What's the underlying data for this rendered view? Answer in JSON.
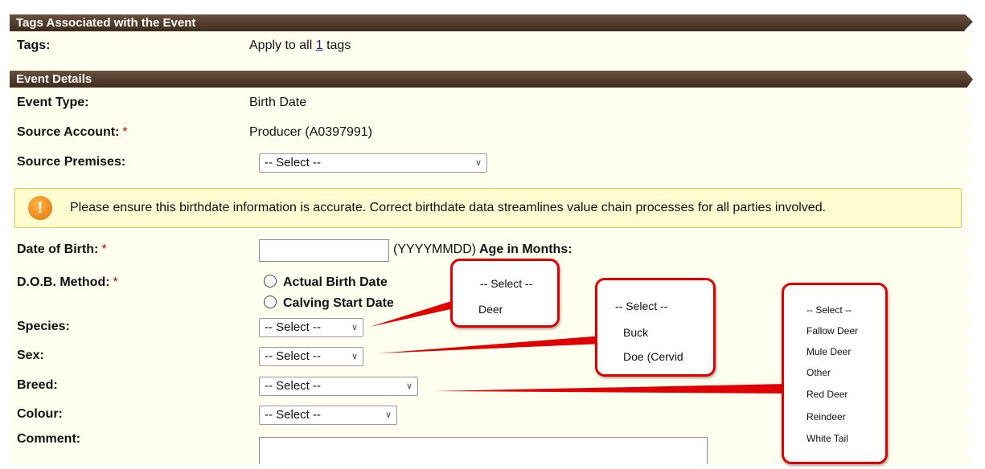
{
  "tags_section": {
    "header": "Tags Associated with the Event"
  },
  "tags_row": {
    "label": "Tags:",
    "prefix": "Apply to all ",
    "count": "1",
    "suffix": " tags"
  },
  "details_section": {
    "header": "Event Details"
  },
  "event_type": {
    "label": "Event Type:",
    "value": "Birth Date"
  },
  "source_account": {
    "label": "Source Account:",
    "required": "*",
    "value": "Producer (A0397991)"
  },
  "source_premises": {
    "label": "Source Premises:",
    "selected": "-- Select --"
  },
  "notice": {
    "text": "Please ensure this birthdate information is accurate. Correct birthdate data streamlines value chain processes for all parties involved.",
    "icon": "exclamation-icon"
  },
  "date_of_birth": {
    "label": "Date of Birth:",
    "required": "*",
    "value": "",
    "format_hint": "(YYYYMMDD)",
    "age_label": "Age in Months:"
  },
  "dob_method": {
    "label": "D.O.B. Method:",
    "required": "*",
    "options": [
      "Actual Birth Date",
      "Calving Start Date"
    ]
  },
  "species": {
    "label": "Species:",
    "selected": "-- Select --"
  },
  "sex": {
    "label": "Sex:",
    "selected": "-- Select --"
  },
  "breed": {
    "label": "Breed:",
    "selected": "-- Select --"
  },
  "colour": {
    "label": "Colour:",
    "selected": "-- Select --"
  },
  "comment": {
    "label": "Comment:"
  },
  "callouts": {
    "species": [
      "-- Select --",
      "Deer"
    ],
    "sex": [
      "-- Select --",
      "Buck",
      "Doe (Cervid"
    ],
    "breed": [
      "-- Select --",
      "Fallow Deer",
      "Mule Deer",
      "Other",
      "Red Deer",
      "Reindeer",
      "White Tail"
    ]
  },
  "colors": {
    "header_bg": "#4e3828",
    "page_bg": "#fffff0",
    "callout_border": "#e00000",
    "required": "#cc0000"
  }
}
